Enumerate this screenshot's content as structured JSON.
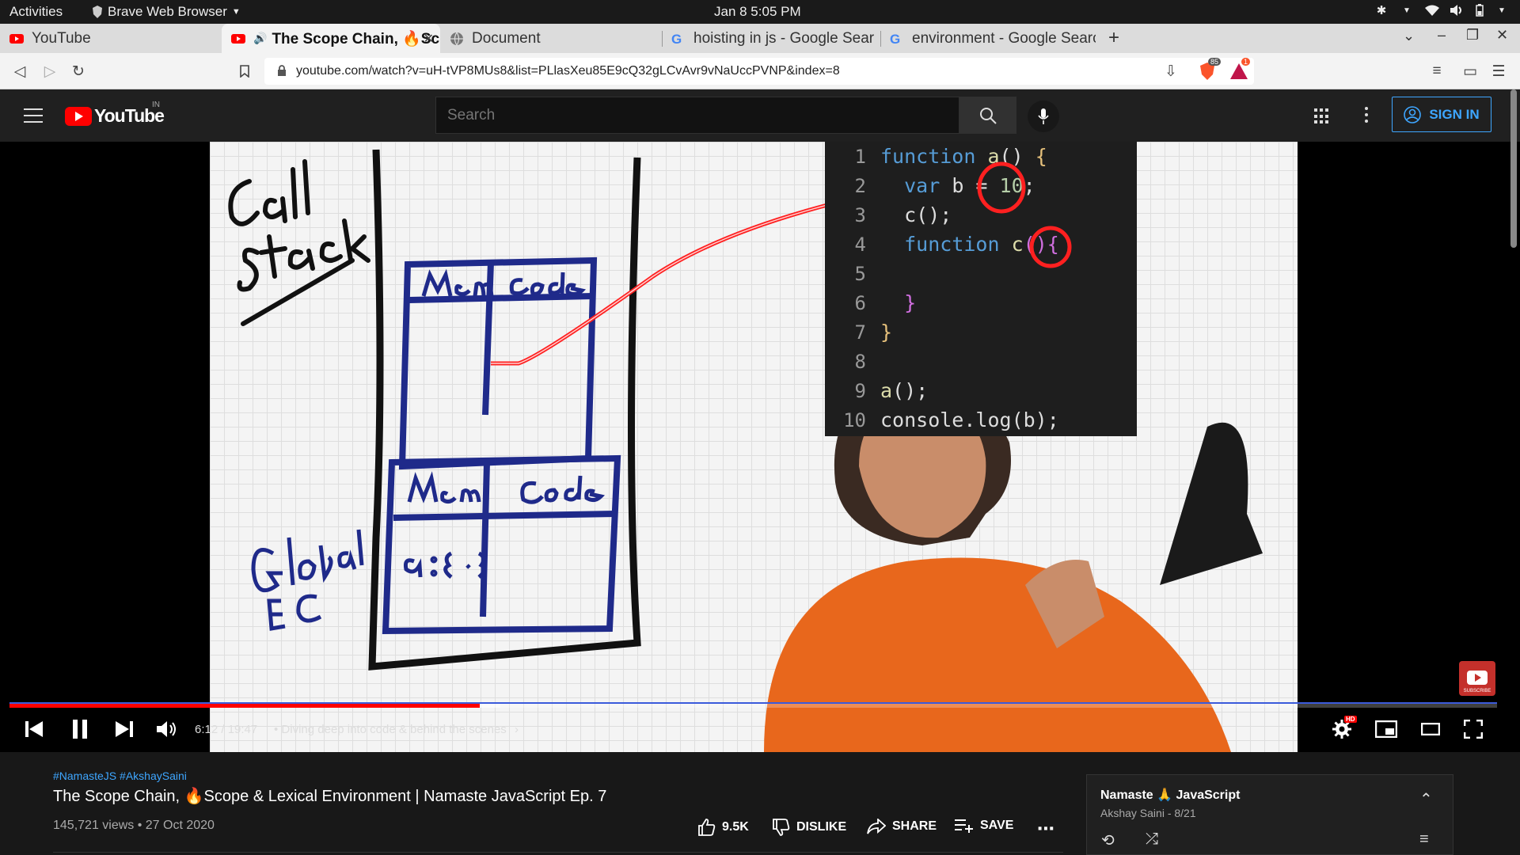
{
  "gnome": {
    "activities": "Activities",
    "app_name": "Brave Web Browser",
    "clock": "Jan 8  5:05 PM"
  },
  "tabs": [
    {
      "label": "YouTube",
      "active": false
    },
    {
      "label": "The Scope Chain, 🔥Sc",
      "active": true
    },
    {
      "label": "Document",
      "active": false
    },
    {
      "label": "hoisting in js - Google Sear",
      "active": false
    },
    {
      "label": "environment - Google Searc",
      "active": false
    }
  ],
  "browser": {
    "url": "youtube.com/watch?v=uH-tVP8MUs8&list=PLlasXeu85E9cQ32gLCvAvr9vNaUccPVNP&index=8",
    "shield_count": "85",
    "rewards_count": "1"
  },
  "youtube": {
    "logo": "YouTube",
    "country": "IN",
    "search_placeholder": "Search",
    "signin_label": "SIGN IN"
  },
  "video": {
    "code_lines": [
      {
        "n": "1",
        "text": "function a() {"
      },
      {
        "n": "2",
        "text": "  var b = 10;"
      },
      {
        "n": "3",
        "text": "  c();"
      },
      {
        "n": "4",
        "text": "  function c(){"
      },
      {
        "n": "5",
        "text": ""
      },
      {
        "n": "6",
        "text": "  }"
      },
      {
        "n": "7",
        "text": "}"
      },
      {
        "n": "8",
        "text": ""
      },
      {
        "n": "9",
        "text": "a();"
      },
      {
        "n": "10",
        "text": "console.log(b);"
      }
    ],
    "subscribe_label": "SUBSCRIBE",
    "hd_badge": "HD",
    "time": "6:12 / 19:47",
    "chapter": "•  Diving deep into code & behind the scenes",
    "progress_played": 0.316,
    "progress_buffered": 0.33
  },
  "info": {
    "hashtags": "#NamasteJS #AkshaySaini",
    "title": "The Scope Chain, 🔥Scope & Lexical Environment | Namaste JavaScript Ep. 7",
    "meta": "145,721 views • 27 Oct 2020",
    "likes": "9.5K",
    "dislike": "DISLIKE",
    "share": "SHARE",
    "save": "SAVE"
  },
  "playlist": {
    "title": "Namaste 🙏 JavaScript",
    "subtitle": "Akshay Saini - 8/21"
  },
  "colors": {
    "accent_blue": "#3ea6ff",
    "yt_red": "#ff0000",
    "marker_blue": "#1f2a8a"
  }
}
